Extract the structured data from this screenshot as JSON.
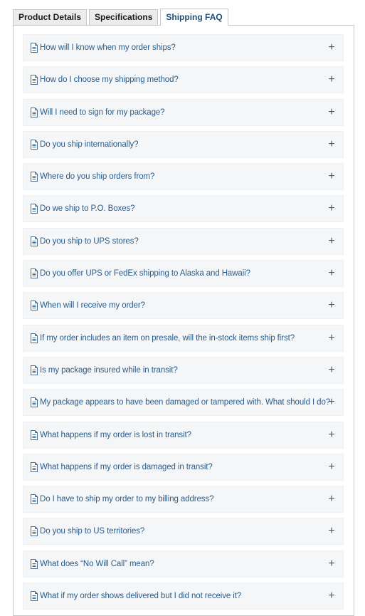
{
  "tabs": [
    {
      "label": "Product Details",
      "active": false
    },
    {
      "label": "Specifications",
      "active": false
    },
    {
      "label": "Shipping FAQ",
      "active": true
    }
  ],
  "expand_symbol": "+",
  "icons": {
    "question": "document-icon",
    "toggle": "plus-icon"
  },
  "colors": {
    "link": "#2a5d8c",
    "active_tab": "#1f4e79",
    "item_bg": "#f5f6f7"
  },
  "faq": [
    "How will I know when my order ships?",
    "How do I choose my shipping method?",
    "Will I need to sign for my package?",
    "Do you ship internationally?",
    "Where do you ship orders from?",
    "Do we ship to P.O. Boxes?",
    "Do you ship to UPS stores?",
    "Do you offer UPS or FedEx shipping to Alaska and Hawaii?",
    "When will I receive my order?",
    "If my order includes an item on presale, will the in-stock items ship first?",
    "Is my package insured while in transit?",
    "My package appears to have been damaged or tampered with. What should I do?",
    "What happens if my order is lost in transit?",
    "What happens if my order is damaged in transit?",
    "Do I have to ship my order to my billing address?",
    "Do you ship to US territories?",
    "What does “No Will Call” mean?",
    "What if my order shows delivered but I did not receive it?"
  ]
}
